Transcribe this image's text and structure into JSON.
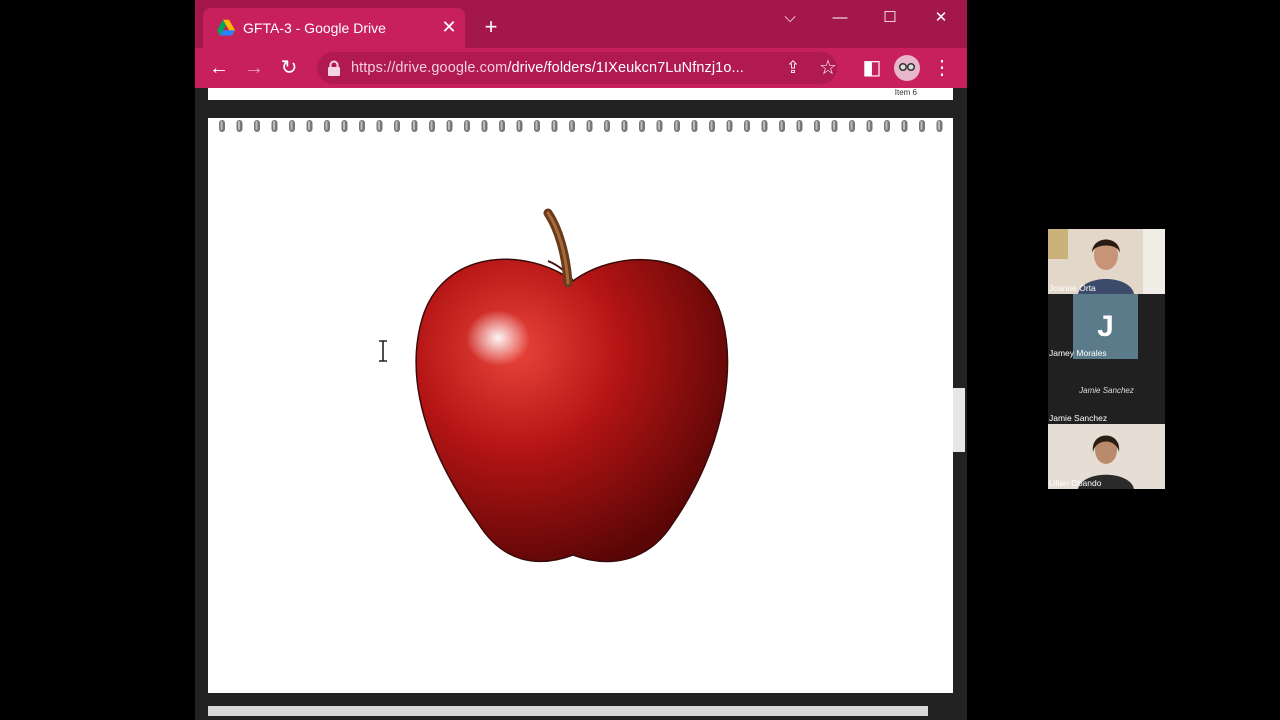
{
  "browser": {
    "tab_title": "GFTA-3 - Google Drive",
    "url_domain": "https://drive.google.com",
    "url_path": "/drive/folders/1IXeukcn7LuNfnzj1o..."
  },
  "page": {
    "previous_item_label": "Item 6"
  },
  "participants": [
    {
      "name": "Joanne Orta"
    },
    {
      "name": "Jamey Morales",
      "initial": "J"
    },
    {
      "name": "Jamie Sanchez",
      "center_label": "Jamie Sanchez"
    },
    {
      "name": "Lilian Obando"
    }
  ],
  "colors": {
    "tab_bar": "#a3174a",
    "toolbar": "#c8205c",
    "apple_red": "#b31414"
  }
}
